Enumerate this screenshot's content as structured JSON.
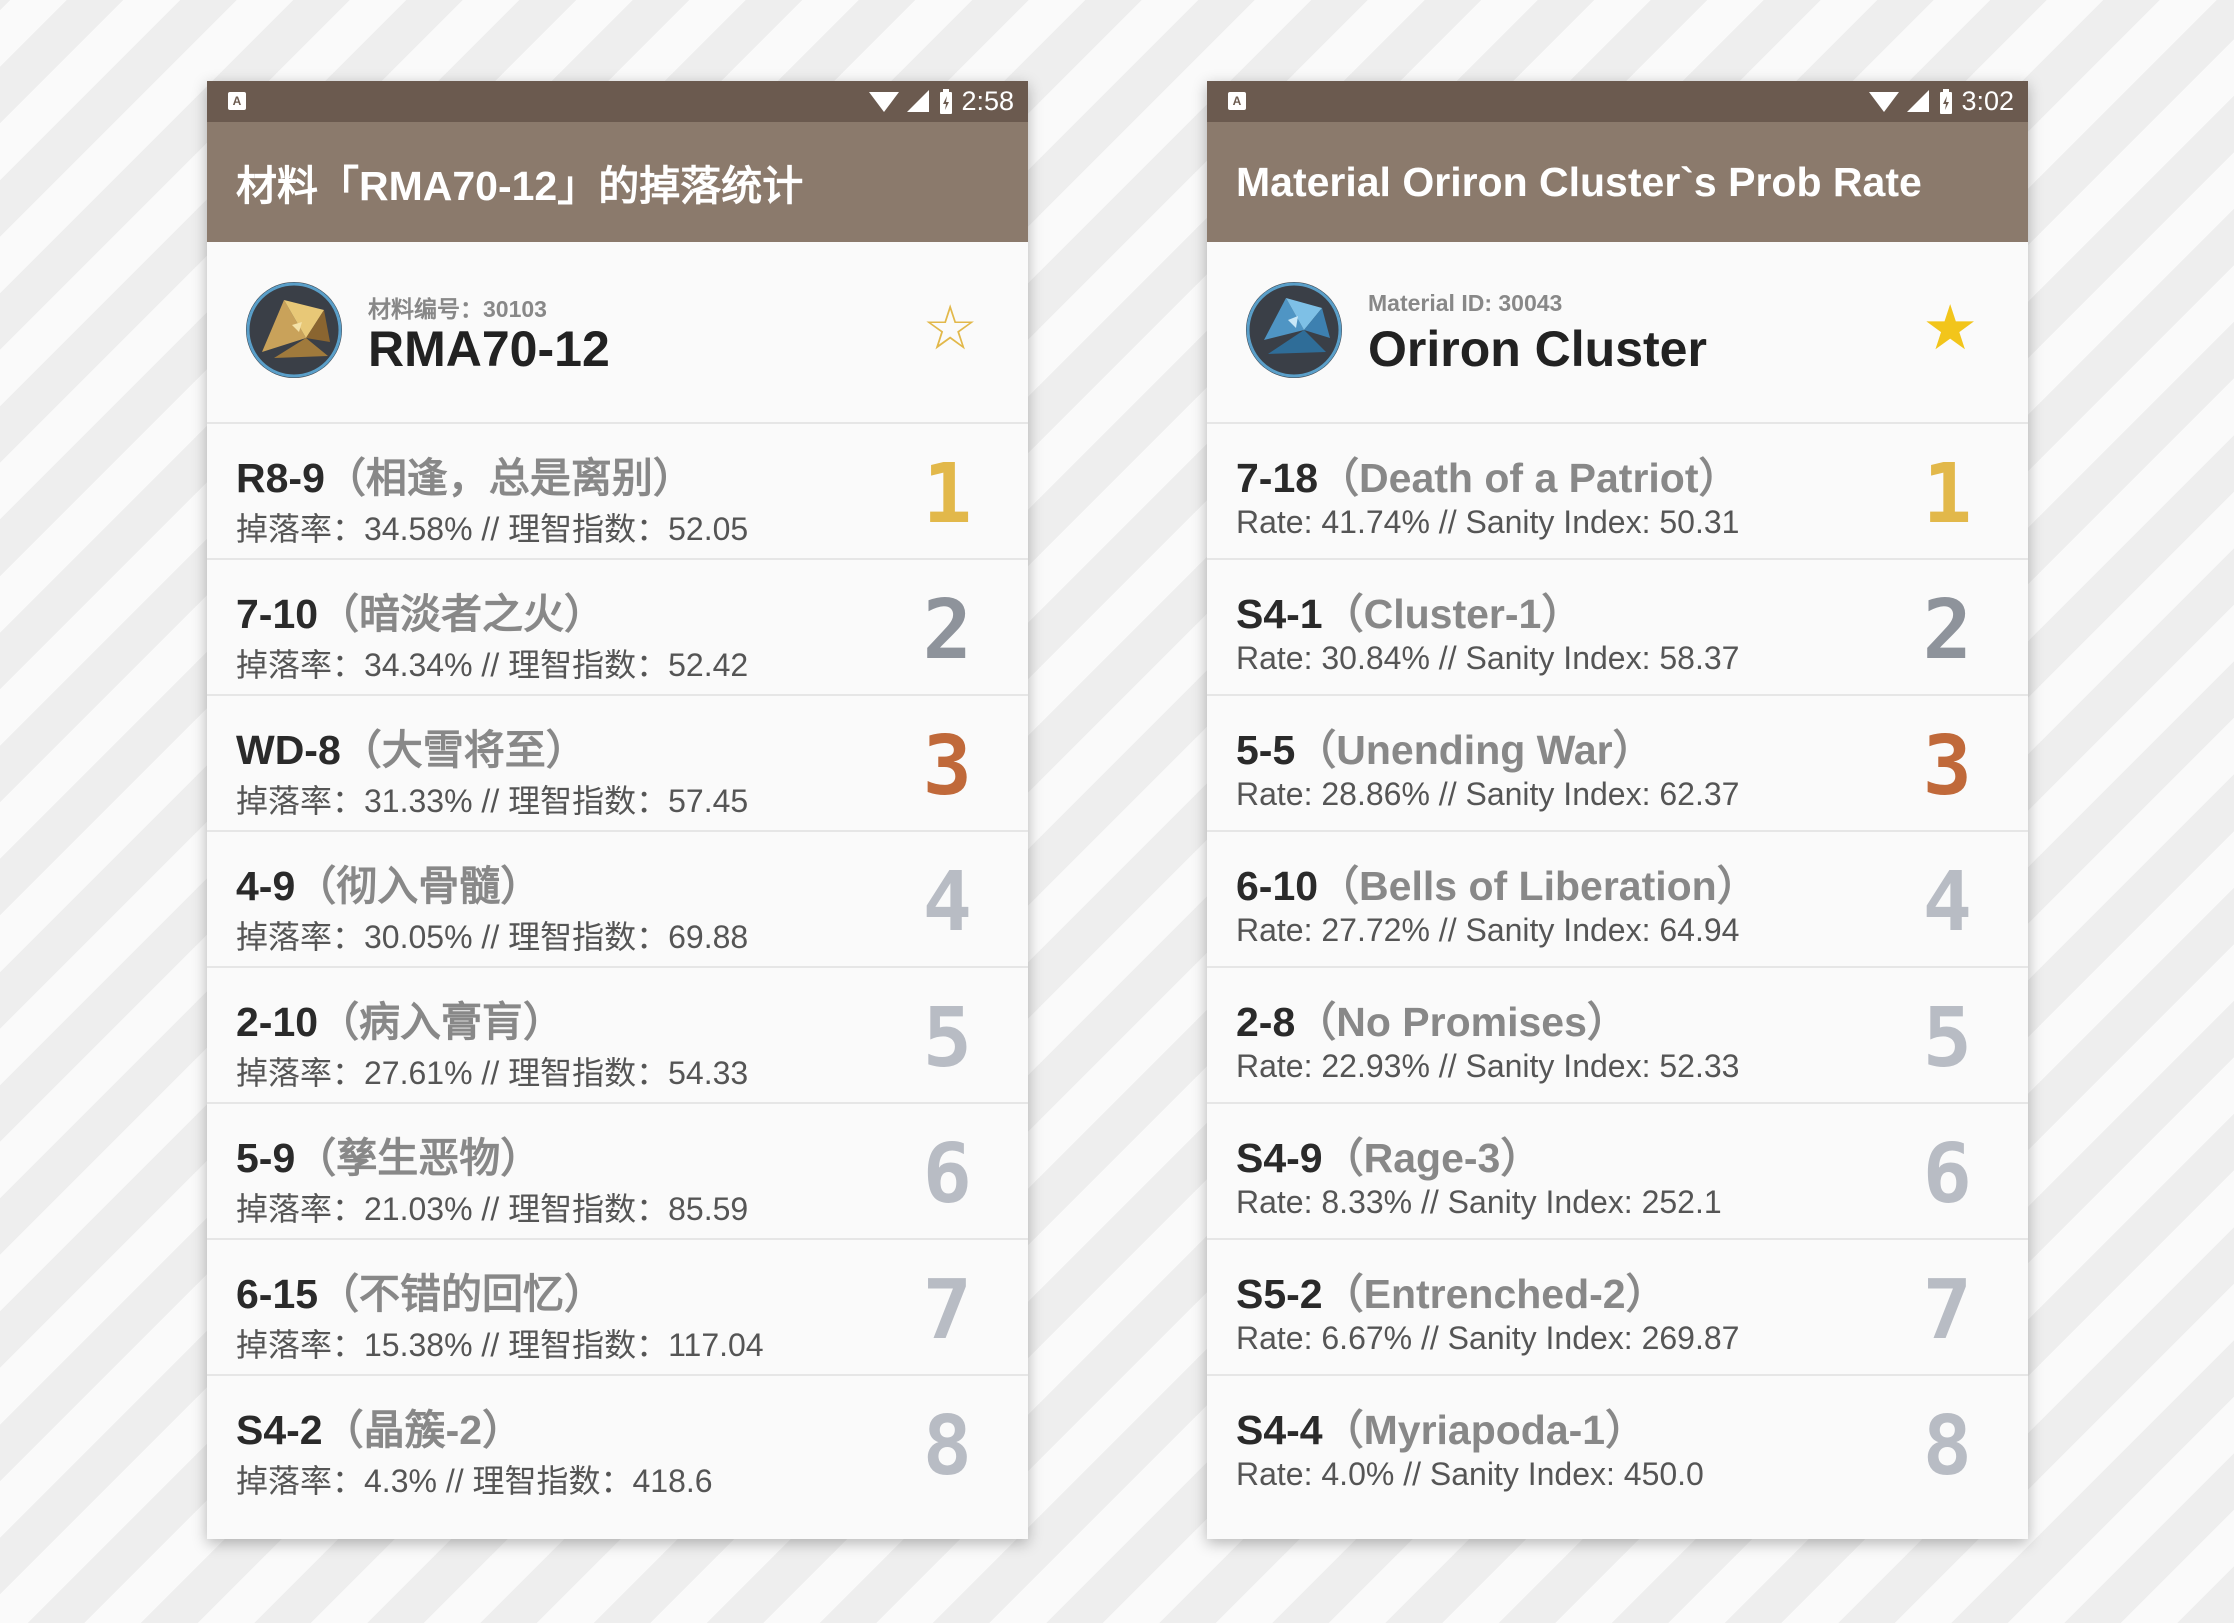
{
  "colors": {
    "statusbar": "#6b5a4f",
    "appbar": "#8b7a6c",
    "rank_gold": "#e2b84a",
    "rank_silver": "#8e939b",
    "rank_bronze": "#c0693a",
    "rank_other": "#b8bcc4"
  },
  "left": {
    "status_time": "2:58",
    "title": "材料「RMA70-12」的掉落统计",
    "material_id": "材料编号：30103",
    "material_name": "RMA70-12",
    "material_icon": "rma70-12-icon",
    "favorite": false,
    "rows": [
      {
        "code": "R8-9",
        "name": "（相逢，总是离别）",
        "sub": "掉落率：34.58% // 理智指数：52.05",
        "rank": "1",
        "rank_color": "#e2b84a"
      },
      {
        "code": "7-10",
        "name": "（暗淡者之火）",
        "sub": "掉落率：34.34% // 理智指数：52.42",
        "rank": "2",
        "rank_color": "#8e939b"
      },
      {
        "code": "WD-8",
        "name": "（大雪将至）",
        "sub": "掉落率：31.33% // 理智指数：57.45",
        "rank": "3",
        "rank_color": "#c0693a"
      },
      {
        "code": "4-9",
        "name": "（彻入骨髓）",
        "sub": "掉落率：30.05% // 理智指数：69.88",
        "rank": "4",
        "rank_color": "#b8bcc4"
      },
      {
        "code": "2-10",
        "name": "（病入膏肓）",
        "sub": "掉落率：27.61% // 理智指数：54.33",
        "rank": "5",
        "rank_color": "#b8bcc4"
      },
      {
        "code": "5-9",
        "name": "（孳生恶物）",
        "sub": "掉落率：21.03% // 理智指数：85.59",
        "rank": "6",
        "rank_color": "#b8bcc4"
      },
      {
        "code": "6-15",
        "name": "（不错的回忆）",
        "sub": "掉落率：15.38% // 理智指数：117.04",
        "rank": "7",
        "rank_color": "#b8bcc4"
      },
      {
        "code": "S4-2",
        "name": "（晶簇-2）",
        "sub": "掉落率：4.3% // 理智指数：418.6",
        "rank": "8",
        "rank_color": "#b8bcc4"
      }
    ]
  },
  "right": {
    "status_time": "3:02",
    "title": "Material Oriron Cluster`s Prob Rate",
    "material_id": "Material ID: 30043",
    "material_name": "Oriron Cluster",
    "material_icon": "oriron-cluster-icon",
    "favorite": true,
    "rows": [
      {
        "code": "7-18",
        "name": "（Death of a Patriot）",
        "sub": "Rate: 41.74% // Sanity Index: 50.31",
        "rank": "1",
        "rank_color": "#e2b84a"
      },
      {
        "code": "S4-1",
        "name": "（Cluster-1）",
        "sub": "Rate: 30.84% // Sanity Index: 58.37",
        "rank": "2",
        "rank_color": "#8e939b"
      },
      {
        "code": "5-5",
        "name": "（Unending War）",
        "sub": "Rate: 28.86% // Sanity Index: 62.37",
        "rank": "3",
        "rank_color": "#c0693a"
      },
      {
        "code": "6-10",
        "name": "（Bells of Liberation）",
        "sub": "Rate: 27.72% // Sanity Index: 64.94",
        "rank": "4",
        "rank_color": "#b8bcc4"
      },
      {
        "code": "2-8",
        "name": "（No Promises）",
        "sub": "Rate: 22.93% // Sanity Index: 52.33",
        "rank": "5",
        "rank_color": "#b8bcc4"
      },
      {
        "code": "S4-9",
        "name": "（Rage-3）",
        "sub": "Rate: 8.33% // Sanity Index: 252.1",
        "rank": "6",
        "rank_color": "#b8bcc4"
      },
      {
        "code": "S5-2",
        "name": "（Entrenched-2）",
        "sub": "Rate: 6.67% // Sanity Index: 269.87",
        "rank": "7",
        "rank_color": "#b8bcc4"
      },
      {
        "code": "S4-4",
        "name": "（Myriapoda-1）",
        "sub": "Rate: 4.0% // Sanity Index: 450.0",
        "rank": "8",
        "rank_color": "#b8bcc4"
      }
    ]
  }
}
